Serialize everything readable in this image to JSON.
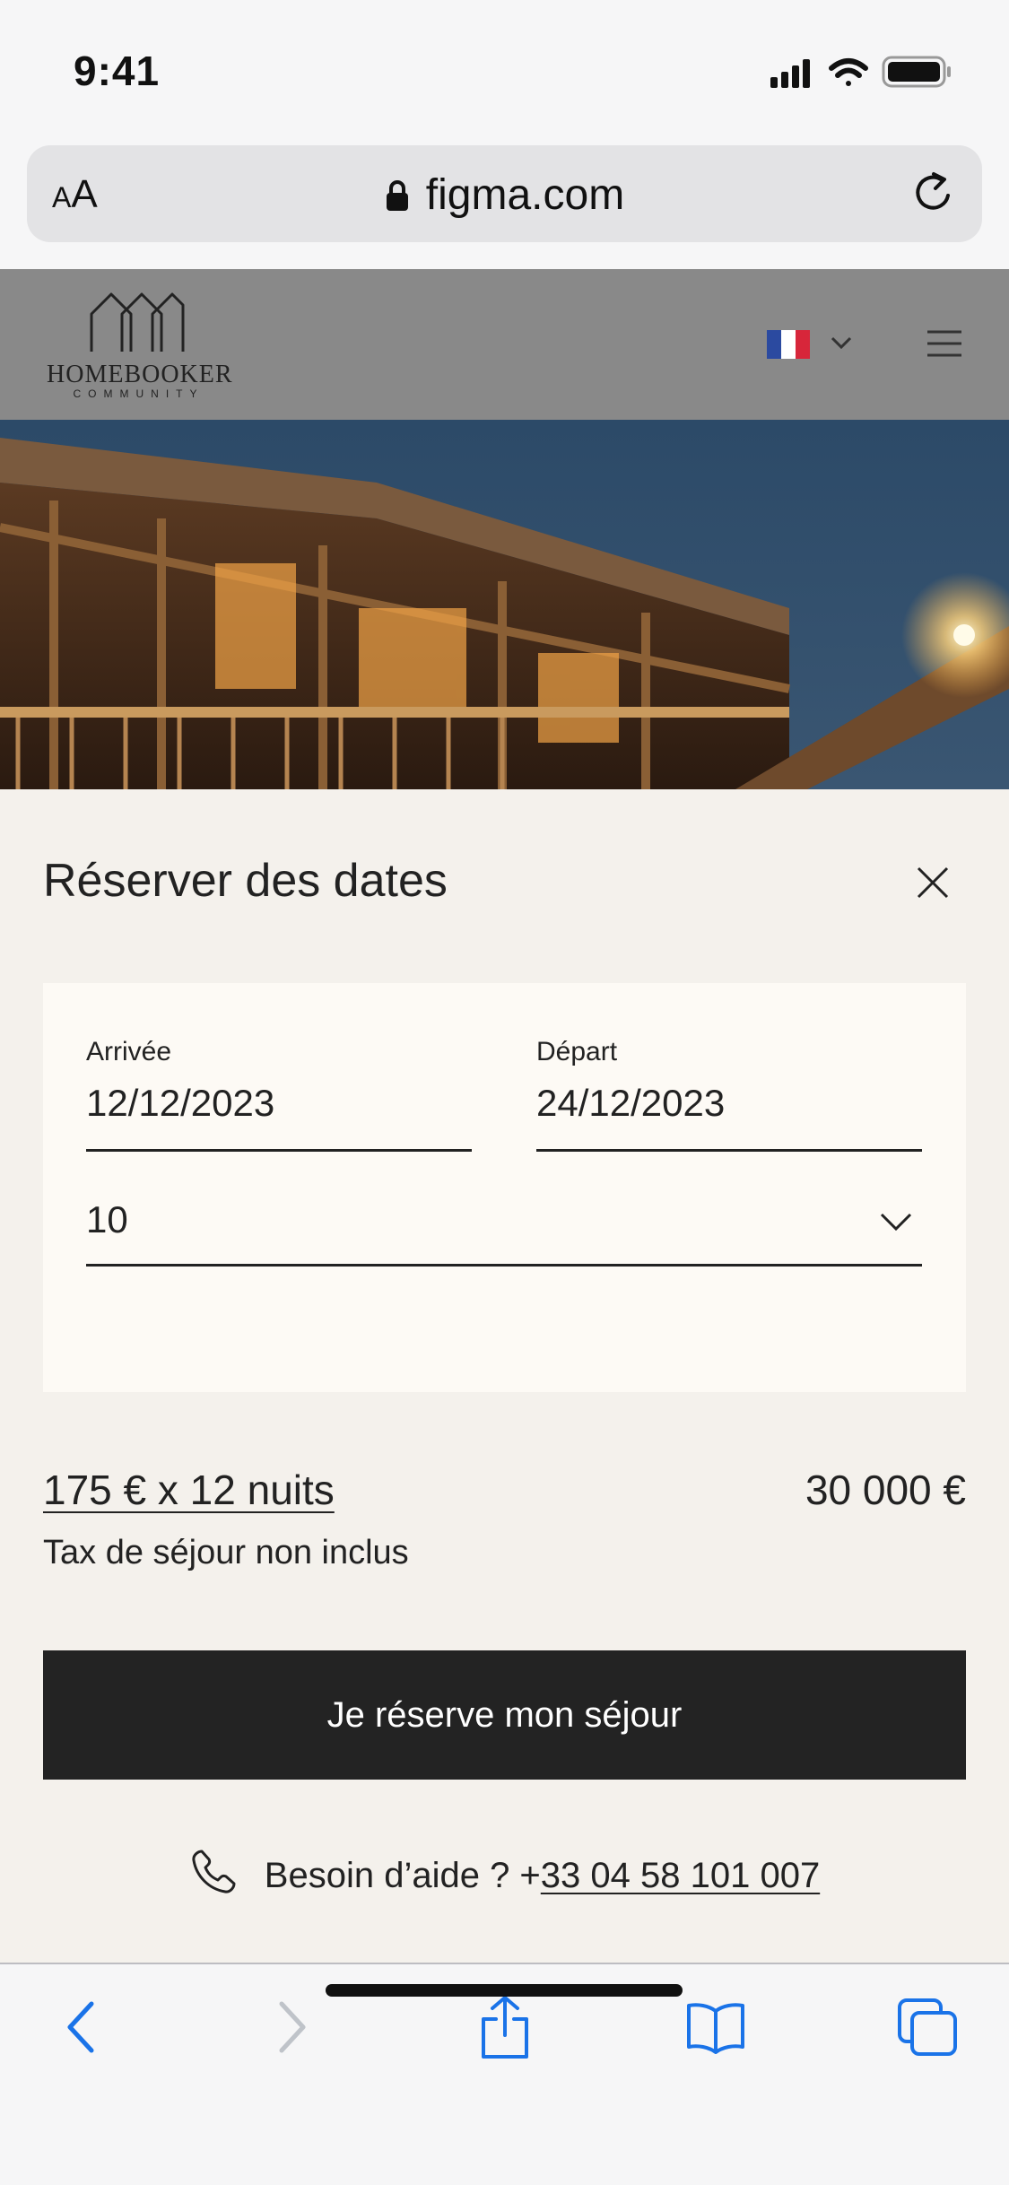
{
  "status_bar": {
    "time": "9:41"
  },
  "browser": {
    "text_size_small": "A",
    "text_size_large": "A",
    "domain": "figma.com"
  },
  "site": {
    "logo_name": "HOMEBOOKER",
    "logo_tagline": "COMMUNITY",
    "language_flag_colors": [
      "#2b4aa0",
      "#ffffff",
      "#d7263a"
    ]
  },
  "booking": {
    "title": "Réserver des dates",
    "arrival": {
      "label": "Arrivée",
      "value": "12/12/2023"
    },
    "departure": {
      "label": "Départ",
      "value": "24/12/2023"
    },
    "guests": {
      "value": "10"
    },
    "price_breakdown": "175 € x 12 nuits",
    "price_total": "30 000 €",
    "tax_note": "Tax de séjour non inclus",
    "cta_label": "Je réserve mon séjour",
    "help_text": "Besoin d’aide ? +",
    "help_phone": "33 04 58 101 007"
  },
  "icons": [
    "signal-icon",
    "wifi-icon",
    "battery-icon",
    "lock-icon",
    "reload-icon",
    "chevron-down-icon",
    "menu-icon",
    "close-icon",
    "phone-icon",
    "back-icon",
    "forward-icon",
    "share-icon",
    "bookmarks-icon",
    "tabs-icon"
  ],
  "colors": {
    "accent": "#1a73e8",
    "cta_bg": "#232323",
    "panel_bg": "#f4f1ec",
    "card_bg": "#fdfaf5"
  }
}
